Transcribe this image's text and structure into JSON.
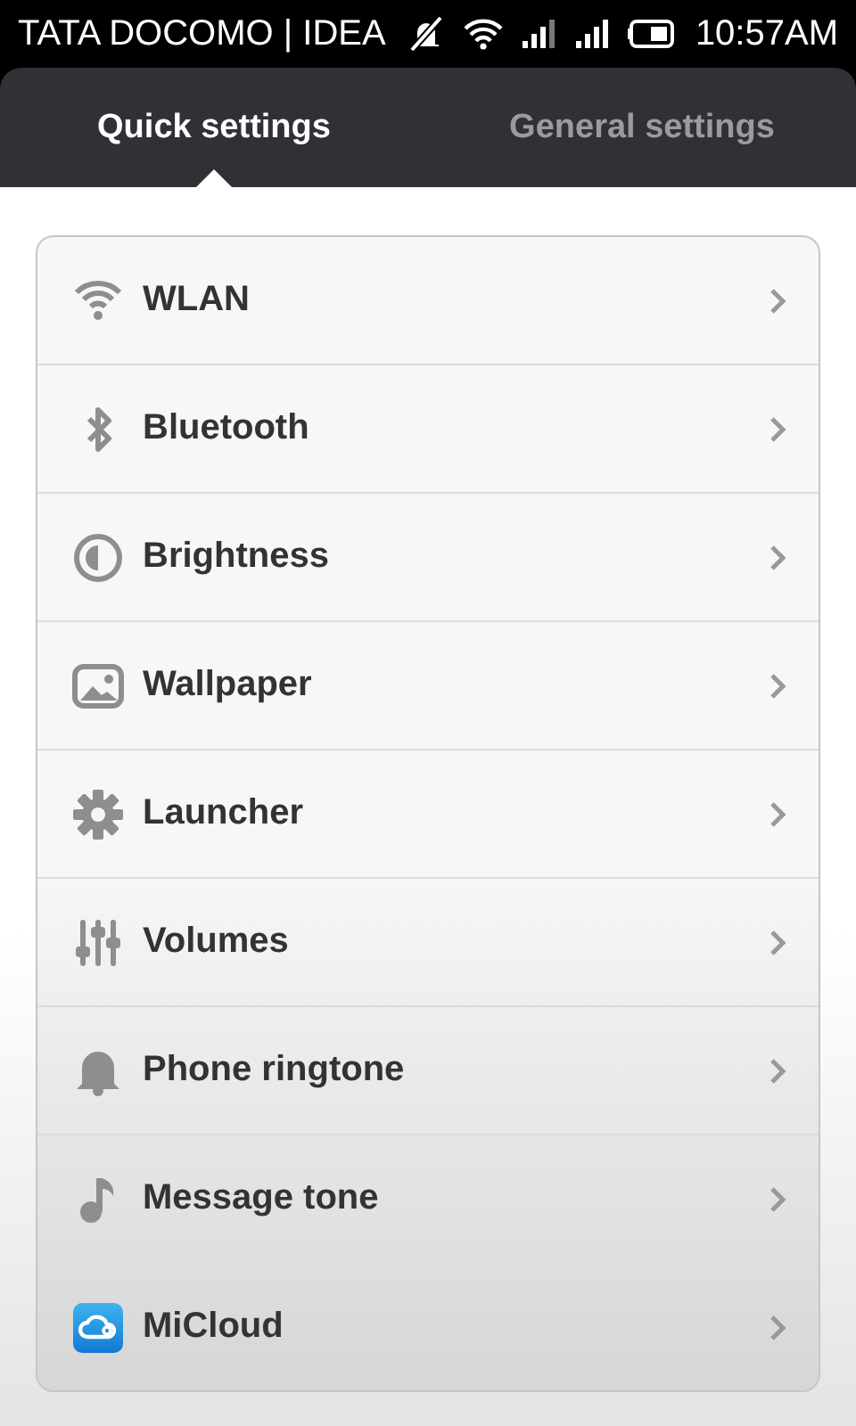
{
  "status_bar": {
    "carrier": "TATA DOCOMO | IDEA",
    "time": "10:57AM"
  },
  "tabs": [
    {
      "label": "Quick settings",
      "selected": true
    },
    {
      "label": "General settings",
      "selected": false
    }
  ],
  "items": [
    {
      "kind": "wlan",
      "label": "WLAN"
    },
    {
      "kind": "bluetooth",
      "label": "Bluetooth"
    },
    {
      "kind": "brightness",
      "label": "Brightness"
    },
    {
      "kind": "wallpaper",
      "label": "Wallpaper"
    },
    {
      "kind": "launcher",
      "label": "Launcher"
    },
    {
      "kind": "volumes",
      "label": "Volumes"
    },
    {
      "kind": "ringtone",
      "label": "Phone ringtone"
    },
    {
      "kind": "tone",
      "label": "Message tone"
    },
    {
      "kind": "cloud",
      "label": "MiCloud"
    }
  ]
}
